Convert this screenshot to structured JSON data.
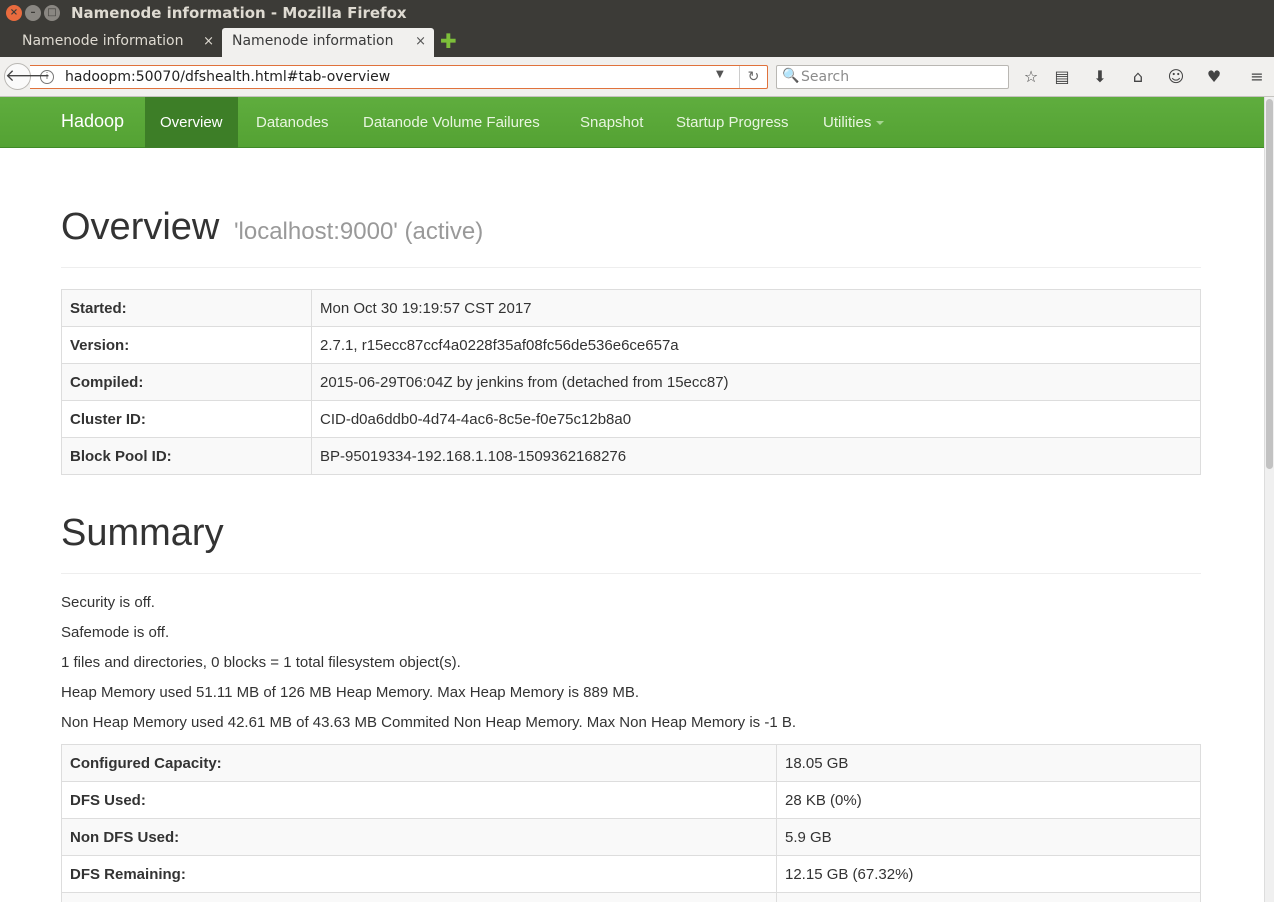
{
  "window": {
    "title": "Namenode information - Mozilla Firefox",
    "close_glyph": "×",
    "min_glyph": "–",
    "max_glyph": "□"
  },
  "tabs": [
    {
      "label": "Namenode information",
      "active": false,
      "close_glyph": "×"
    },
    {
      "label": "Namenode information",
      "active": true,
      "close_glyph": "×"
    }
  ],
  "newtab_glyph": "✚",
  "toolbar": {
    "back_glyph": "🡐",
    "info_glyph": "i",
    "url": "hadoopm:50070/dfshealth.html#tab-overview",
    "dropdown_glyph": "▼",
    "reload_glyph": "↻",
    "search_icon_glyph": "🔍",
    "search_placeholder": "Search",
    "icons": {
      "bookmark": "☆",
      "reading_list": "▤",
      "download": "⬇",
      "home": "⌂",
      "chat": "☺",
      "pocket": "♥",
      "menu": "≡"
    }
  },
  "navbar": {
    "brand": "Hadoop",
    "items": [
      "Overview",
      "Datanodes",
      "Datanode Volume Failures",
      "Snapshot",
      "Startup Progress",
      "Utilities"
    ],
    "active_index": 0,
    "accent_color": "#5aa838",
    "active_color": "#3d7e27"
  },
  "overview": {
    "title": "Overview",
    "subtitle": "'localhost:9000' (active)",
    "rows": [
      {
        "key": "Started:",
        "value": "Mon Oct 30 19:19:57 CST 2017"
      },
      {
        "key": "Version:",
        "value": "2.7.1, r15ecc87ccf4a0228f35af08fc56de536e6ce657a"
      },
      {
        "key": "Compiled:",
        "value": "2015-06-29T06:04Z by jenkins from (detached from 15ecc87)"
      },
      {
        "key": "Cluster ID:",
        "value": "CID-d0a6ddb0-4d74-4ac6-8c5e-f0e75c12b8a0"
      },
      {
        "key": "Block Pool ID:",
        "value": "BP-95019334-192.168.1.108-1509362168276"
      }
    ]
  },
  "summary": {
    "title": "Summary",
    "lines": [
      "Security is off.",
      "Safemode is off.",
      "1 files and directories, 0 blocks = 1 total filesystem object(s).",
      "Heap Memory used 51.11 MB of 126 MB Heap Memory. Max Heap Memory is 889 MB.",
      "Non Heap Memory used 42.61 MB of 43.63 MB Commited Non Heap Memory. Max Non Heap Memory is -1 B."
    ],
    "rows": [
      {
        "key": "Configured Capacity:",
        "value": "18.05 GB"
      },
      {
        "key": "DFS Used:",
        "value": "28 KB (0%)"
      },
      {
        "key": "Non DFS Used:",
        "value": "5.9 GB"
      },
      {
        "key": "DFS Remaining:",
        "value": "12.15 GB (67.32%)"
      },
      {
        "key": "",
        "value": ""
      }
    ]
  }
}
